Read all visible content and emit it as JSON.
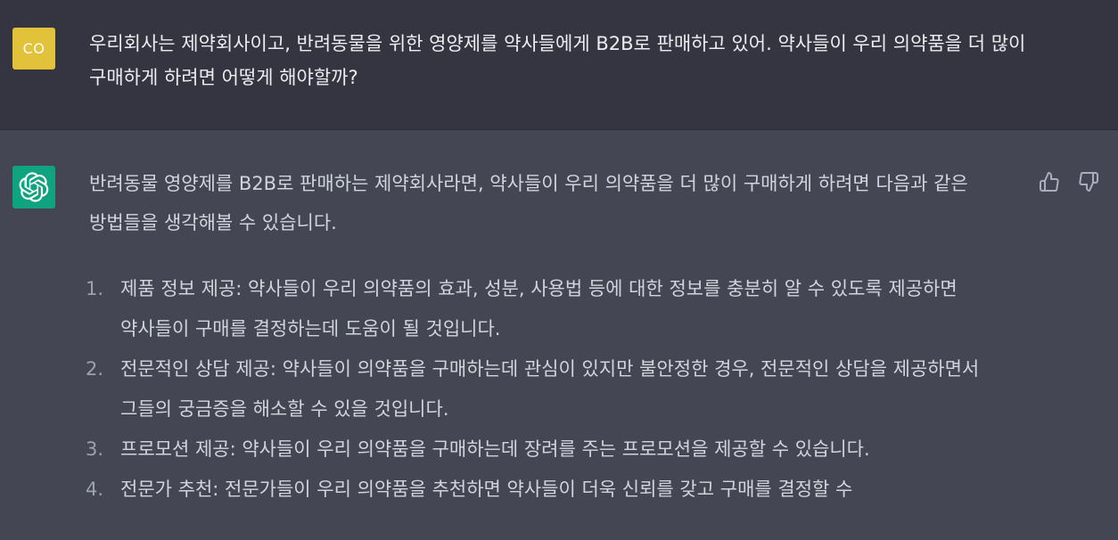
{
  "user_message": {
    "avatar_initials": "CO",
    "text": "우리회사는 제약회사이고, 반려동물을 위한 영양제를 약사들에게 B2B로 판매하고 있어. 약사들이 우리 의약품을 더 많이 구매하게 하려면 어떻게 해야할까?"
  },
  "assistant_message": {
    "avatar_icon": "openai-logo-icon",
    "intro": "반려동물 영양제를 B2B로 판매하는 제약회사라면, 약사들이 우리 의약품을 더 많이 구매하게 하려면 다음과 같은 방법들을 생각해볼 수 있습니다.",
    "items": [
      {
        "num": "1.",
        "text": "제품 정보 제공: 약사들이 우리 의약품의 효과, 성분, 사용법 등에 대한 정보를 충분히 알 수 있도록 제공하면 약사들이 구매를 결정하는데 도움이 될 것입니다."
      },
      {
        "num": "2.",
        "text": "전문적인 상담 제공: 약사들이 의약품을 구매하는데 관심이 있지만 불안정한 경우, 전문적인 상담을 제공하면서 그들의 궁금증을 해소할 수 있을 것입니다."
      },
      {
        "num": "3.",
        "text": "프로모션 제공: 약사들이 우리 의약품을 구매하는데 장려를 주는 프로모션을 제공할 수 있습니다."
      },
      {
        "num": "4.",
        "text": "전문가 추천: 전문가들이 우리 의약품을 추천하면 약사들이 더욱 신뢰를 갖고 구매를 결정할 수"
      }
    ],
    "feedback": {
      "thumbs_up_icon": "thumbs-up-icon",
      "thumbs_down_icon": "thumbs-down-icon"
    }
  },
  "colors": {
    "user_bg": "#343541",
    "assistant_bg": "#444654",
    "user_avatar": "#e1c23a",
    "bot_avatar": "#10a37f",
    "text": "#ececf1"
  }
}
